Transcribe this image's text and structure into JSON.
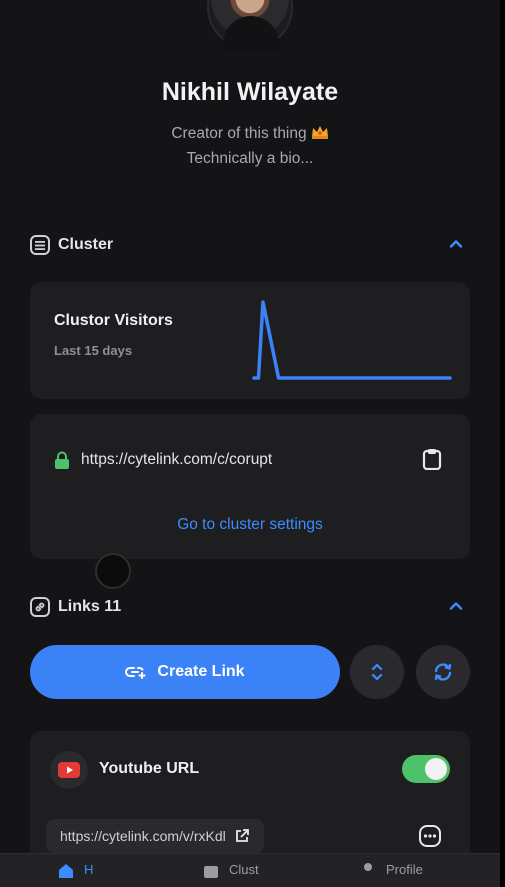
{
  "profile": {
    "name": "Nikhil Wilayate",
    "bio_line1": "Creator of this thing",
    "bio_line2": "Technically a bio..."
  },
  "cluster": {
    "section_title": "Cluster",
    "visitors_title": "Clustor Visitors",
    "visitors_period": "Last 15 days",
    "chart_data": {
      "type": "line",
      "x": [
        1,
        2,
        3,
        4,
        5,
        6,
        7,
        8,
        9,
        10,
        11,
        12,
        13,
        14,
        15
      ],
      "values": [
        0,
        0,
        1,
        0,
        0,
        0,
        0,
        0,
        0,
        0,
        0,
        0,
        0,
        0,
        0
      ],
      "title": "",
      "xlabel": "",
      "ylabel": "",
      "grid": false,
      "color": "#3b82f6"
    },
    "url": "https://cytelink.com/c/corupt",
    "settings_link": "Go to cluster settings"
  },
  "links": {
    "section_title": "Links 11",
    "create_label": "Create Link",
    "items": [
      {
        "title": "Youtube URL",
        "url": "https://cytelink.com/v/rxKdl",
        "enabled": true,
        "icon": "youtube-icon"
      }
    ]
  },
  "nav": {
    "items": [
      {
        "label": "H",
        "icon": "home-icon"
      },
      {
        "label": "Clust",
        "icon": "chart-icon"
      },
      {
        "label": "Profile",
        "icon": "person-icon"
      }
    ]
  },
  "colors": {
    "accent": "#3b82f6",
    "link": "#3b8cff",
    "toggle_on": "#4ec26a",
    "lock": "#4ec26a",
    "youtube": "#e53935"
  }
}
